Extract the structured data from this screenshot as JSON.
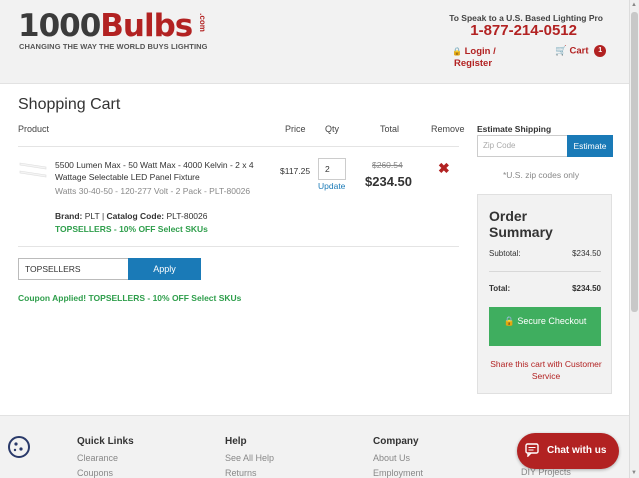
{
  "header": {
    "logo_number": "1000",
    "logo_word": "Bulbs",
    "logo_suffix": ".com",
    "tagline": "CHANGING THE WAY THE WORLD BUYS LIGHTING",
    "speak_text": "To Speak to a U.S. Based Lighting Pro",
    "phone": "1-877-214-0512",
    "login_label": "Login /",
    "register_label": "Register",
    "cart_label": "Cart",
    "cart_count": "1"
  },
  "cart": {
    "title": "Shopping Cart",
    "columns": {
      "product": "Product",
      "price": "Price",
      "qty": "Qty",
      "total": "Total",
      "remove": "Remove"
    },
    "item": {
      "name": "5500 Lumen Max - 50 Watt Max - 4000 Kelvin - 2 x 4 Wattage Selectable LED Panel Fixture",
      "spec": "Watts 30-40-50 - 120-277 Volt - 2 Pack - PLT-80026",
      "brand_label": "Brand:",
      "brand_value": "PLT",
      "catalog_label": "Catalog Code:",
      "catalog_value": "PLT-80026",
      "promo": "TOPSELLERS - 10% OFF Select SKUs",
      "price": "$117.25",
      "qty": "2",
      "update_label": "Update",
      "old_total": "$260.54",
      "new_total": "$234.50"
    },
    "coupon": {
      "value": "TOPSELLERS",
      "apply_label": "Apply",
      "applied_message": "Coupon Applied! TOPSELLERS - 10% OFF Select SKUs"
    }
  },
  "shipping": {
    "title": "Estimate Shipping",
    "zip_placeholder": "Zip Code",
    "estimate_label": "Estimate",
    "note": "*U.S. zip codes only"
  },
  "summary": {
    "title": "Order Summary",
    "subtotal_label": "Subtotal:",
    "subtotal_value": "$234.50",
    "total_label": "Total:",
    "total_value": "$234.50",
    "checkout_label": "Secure Checkout",
    "share_label": "Share this cart with Customer Service"
  },
  "footer": {
    "quick_links": {
      "title": "Quick Links",
      "links": [
        "Clearance",
        "Coupons"
      ]
    },
    "help": {
      "title": "Help",
      "links": [
        "See All Help",
        "Returns"
      ]
    },
    "company": {
      "title": "Company",
      "links": [
        "About Us",
        "Employment"
      ]
    },
    "diy": "DIY Projects",
    "chat_label": "Chat with us"
  },
  "colors": {
    "brand_red": "#b22222",
    "blue": "#1a7ab7",
    "green": "#3fae5f",
    "promo_green": "#2e9e4b"
  },
  "icons": [
    "lock-icon",
    "cart-icon",
    "remove-x-icon",
    "cookie-icon",
    "chat-bubble-icon"
  ]
}
